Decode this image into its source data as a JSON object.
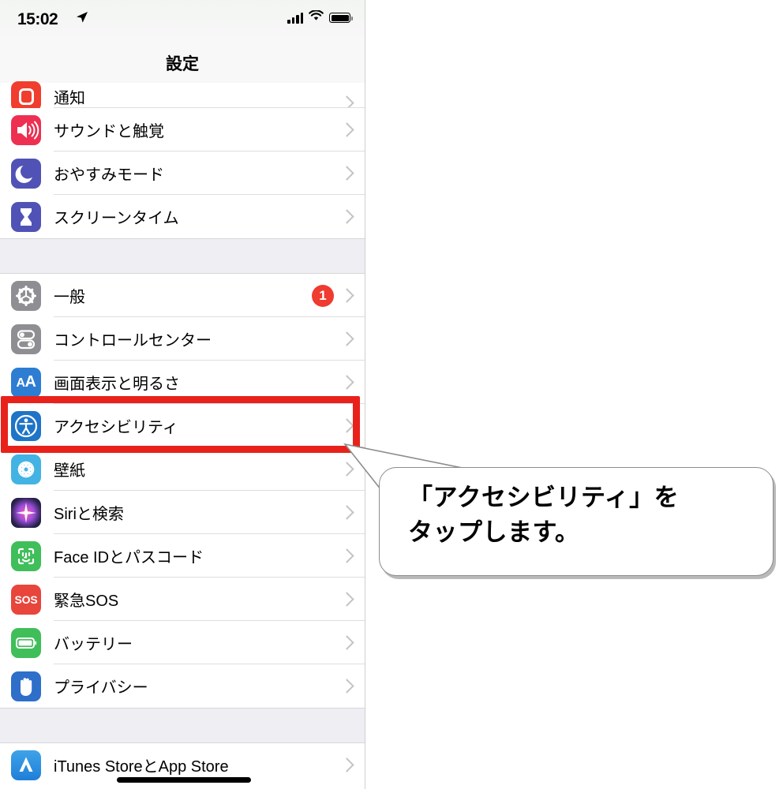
{
  "status_bar": {
    "time": "15:02",
    "location_icon": "location-arrow-icon",
    "signal_icon": "cellular-signal-icon",
    "wifi_icon": "wifi-icon",
    "battery_icon": "battery-full-icon"
  },
  "nav": {
    "title": "設定"
  },
  "groups": [
    {
      "rows": [
        {
          "label": "通知",
          "icon": "notifications-icon",
          "icon_class": "ic-notif",
          "badge": "",
          "clipped": true
        },
        {
          "label": "サウンドと触覚",
          "icon": "sounds-haptics-icon",
          "icon_class": "ic-sound",
          "badge": "",
          "clipped": false
        },
        {
          "label": "おやすみモード",
          "icon": "do-not-disturb-icon",
          "icon_class": "ic-dnd",
          "badge": "",
          "clipped": false
        },
        {
          "label": "スクリーンタイム",
          "icon": "screen-time-icon",
          "icon_class": "ic-screen",
          "badge": "",
          "clipped": false
        }
      ]
    },
    {
      "rows": [
        {
          "label": "一般",
          "icon": "general-gear-icon",
          "icon_class": "ic-gen",
          "badge": "1",
          "clipped": false
        },
        {
          "label": "コントロールセンター",
          "icon": "control-center-icon",
          "icon_class": "ic-cc",
          "badge": "",
          "clipped": false
        },
        {
          "label": "画面表示と明るさ",
          "icon": "display-brightness-icon",
          "icon_class": "ic-disp",
          "badge": "",
          "clipped": false
        },
        {
          "label": "アクセシビリティ",
          "icon": "accessibility-icon",
          "icon_class": "ic-acc",
          "badge": "",
          "clipped": false
        },
        {
          "label": "壁紙",
          "icon": "wallpaper-icon",
          "icon_class": "ic-wall",
          "badge": "",
          "clipped": false
        },
        {
          "label": "Siriと検索",
          "icon": "siri-search-icon",
          "icon_class": "ic-siri",
          "badge": "",
          "clipped": false
        },
        {
          "label": "Face IDとパスコード",
          "icon": "face-id-icon",
          "icon_class": "ic-faceid",
          "badge": "",
          "clipped": false
        },
        {
          "label": "緊急SOS",
          "icon": "emergency-sos-icon",
          "icon_class": "ic-sos",
          "badge": "",
          "clipped": false
        },
        {
          "label": "バッテリー",
          "icon": "battery-settings-icon",
          "icon_class": "ic-batt",
          "badge": "",
          "clipped": false
        },
        {
          "label": "プライバシー",
          "icon": "privacy-hand-icon",
          "icon_class": "ic-priv",
          "badge": "",
          "clipped": false
        }
      ]
    },
    {
      "rows": [
        {
          "label": "iTunes StoreとApp Store",
          "icon": "app-store-icon",
          "icon_class": "ic-store",
          "badge": "",
          "clipped": false
        }
      ]
    }
  ],
  "highlight": {
    "target_label": "アクセシビリティ",
    "color": "#e8221b"
  },
  "callout": {
    "line1": "「アクセシビリティ」を",
    "line2": "タップします。",
    "text": "「アクセシビリティ」を\nタップします。"
  },
  "colors": {
    "accent_red": "#e8221b",
    "badge_red": "#ef3b30",
    "separator": "#dededf",
    "group_gap": "#eeeef3",
    "chevron": "#c4c4c6"
  }
}
